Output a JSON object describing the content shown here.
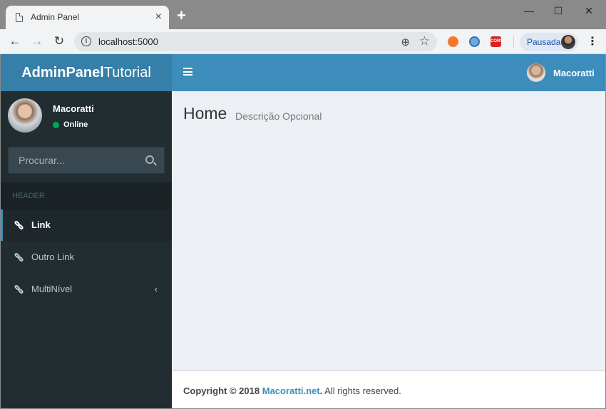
{
  "browser": {
    "tab_title": "Admin Panel",
    "tab_close": "×",
    "new_tab": "+",
    "url": "localhost:5000",
    "profile_label": "Pausada",
    "window_controls": {
      "minimize": "—",
      "maximize": "☐",
      "close": "✕"
    },
    "ext_cors_label": "CORS"
  },
  "app": {
    "logo": {
      "bold": "AdminPanel",
      "light": "Tutorial"
    },
    "topbar": {
      "user_name": "Macoratti"
    },
    "sidebar": {
      "user_name": "Macoratti",
      "status": "Online",
      "search_placeholder": "Procurar...",
      "header": "HEADER",
      "items": [
        {
          "label": "Link",
          "active": true
        },
        {
          "label": "Outro Link",
          "active": false
        },
        {
          "label": "MultiNível",
          "active": false,
          "has_children": true
        }
      ]
    },
    "content": {
      "title": "Home",
      "description": "Descrição Opcional"
    },
    "footer": {
      "copyright": "Copyright © 2018",
      "link": "Macoratti.net",
      "suffix": " All rights reserved."
    }
  },
  "colors": {
    "topbar": "#3c8dbc",
    "logo_bar": "#367fa9",
    "sidebar": "#222d32",
    "content_bg": "#ecf0f5",
    "online": "#00a65a"
  }
}
